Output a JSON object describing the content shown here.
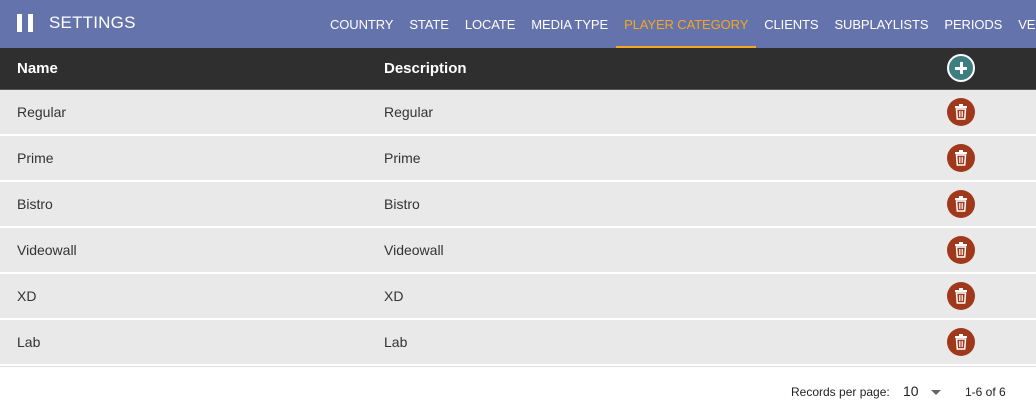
{
  "header": {
    "title": "SETTINGS",
    "icon": "pause-icon",
    "tabs": [
      {
        "label": "COUNTRY",
        "name": "country",
        "active": false
      },
      {
        "label": "STATE",
        "name": "state",
        "active": false
      },
      {
        "label": "LOCATE",
        "name": "locate",
        "active": false
      },
      {
        "label": "MEDIA TYPE",
        "name": "media-type",
        "active": false
      },
      {
        "label": "PLAYER CATEGORY",
        "name": "player-category",
        "active": true
      },
      {
        "label": "CLIENTS",
        "name": "clients",
        "active": false
      },
      {
        "label": "SUBPLAYLISTS",
        "name": "subplaylists",
        "active": false
      },
      {
        "label": "PERIODS",
        "name": "periods",
        "active": false
      },
      {
        "label": "VERSION",
        "name": "version",
        "active": false
      }
    ]
  },
  "table": {
    "columns": {
      "name": "Name",
      "description": "Description"
    },
    "add_icon": "plus-circle-icon",
    "delete_icon": "trash-icon",
    "rows": [
      {
        "name": "Regular",
        "description": "Regular"
      },
      {
        "name": "Prime",
        "description": "Prime"
      },
      {
        "name": "Bistro",
        "description": "Bistro"
      },
      {
        "name": "Videowall",
        "description": "Videowall"
      },
      {
        "name": "XD",
        "description": "XD"
      },
      {
        "name": "Lab",
        "description": "Lab"
      }
    ]
  },
  "footer": {
    "records_per_page_label": "Records per page:",
    "records_per_page_value": "10",
    "range_text": "1-6 of 6"
  },
  "colors": {
    "header_bg": "#6573ac",
    "active_tab": "#f5a623",
    "table_header_bg": "#2f2f2f",
    "row_bg": "#e9e9e9",
    "add_button": "#3d7f80",
    "delete_button": "#a0381c"
  }
}
